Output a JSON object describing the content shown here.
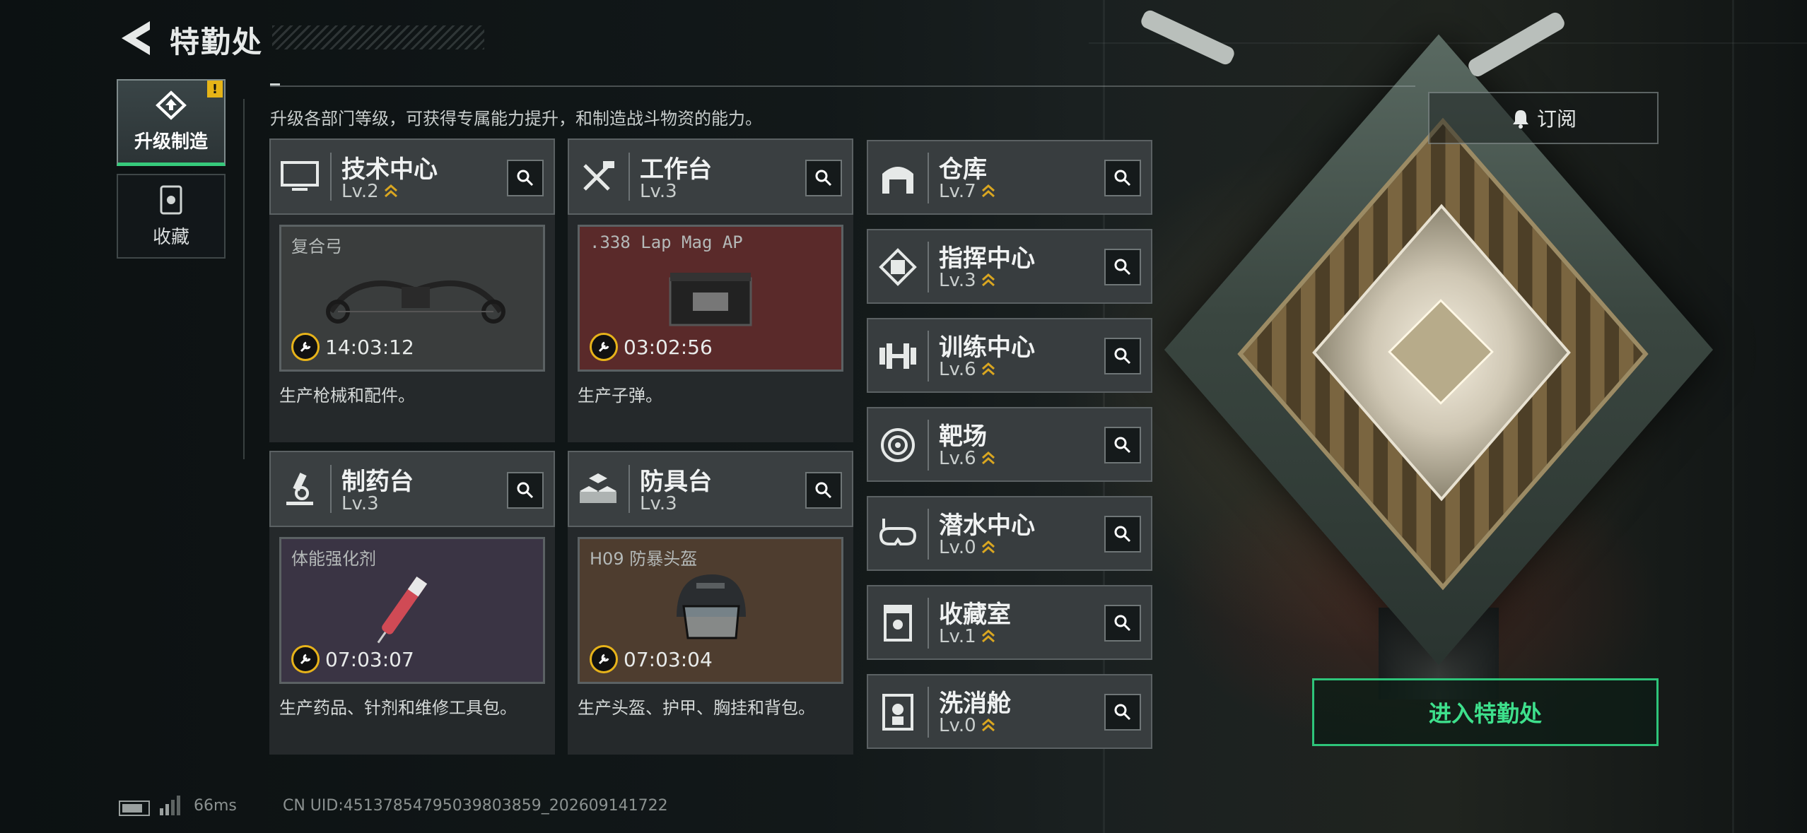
{
  "header": {
    "title": "特勤处",
    "description": "升级各部门等级，可获得专属能力提升，和制造战斗物资的能力。"
  },
  "tabs": [
    {
      "label": "升级制造",
      "icon": "upgrade-icon",
      "active": true,
      "badge": "!"
    },
    {
      "label": "收藏",
      "icon": "collection-icon",
      "active": false
    }
  ],
  "production": [
    {
      "title": "技术中心",
      "level": "Lv.2",
      "icon": "monitor-icon",
      "product": "复合弓",
      "timer": "14:03:12",
      "desc": "生产枪械和配件。",
      "color": "#3a3d3d"
    },
    {
      "title": "工作台",
      "level": "Lv.3",
      "icon": "tools-icon",
      "product": ".338 Lap Mag AP",
      "timer": "03:02:56",
      "desc": "生产子弹。",
      "color": "#5a2a2a"
    },
    {
      "title": "制药台",
      "level": "Lv.3",
      "icon": "microscope-icon",
      "product": "体能强化剂",
      "timer": "07:03:07",
      "desc": "生产药品、针剂和维修工具包。",
      "color": "#3a3444"
    },
    {
      "title": "防具台",
      "level": "Lv.3",
      "icon": "armor-blocks-icon",
      "product": "H09 防暴头盔",
      "timer": "07:03:04",
      "desc": "生产头盔、护甲、胸挂和背包。",
      "color": "#4e3d2f"
    }
  ],
  "facilities": [
    {
      "title": "仓库",
      "level": "Lv.7",
      "icon": "warehouse-icon"
    },
    {
      "title": "指挥中心",
      "level": "Lv.3",
      "icon": "command-chip-icon"
    },
    {
      "title": "训练中心",
      "level": "Lv.6",
      "icon": "dumbbell-icon"
    },
    {
      "title": "靶场",
      "level": "Lv.6",
      "icon": "target-icon"
    },
    {
      "title": "潜水中心",
      "level": "Lv.0",
      "icon": "diving-mask-icon"
    },
    {
      "title": "收藏室",
      "level": "Lv.1",
      "icon": "display-case-icon"
    },
    {
      "title": "洗消舱",
      "level": "Lv.0",
      "icon": "decon-pod-icon"
    }
  ],
  "buttons": {
    "subscribe": "订阅",
    "enter": "进入特勤处"
  },
  "footer": {
    "ping": "66ms",
    "uid": "CN UID:4513785479503980385​9_202609141722"
  },
  "colors": {
    "accent_green": "#2ec47a",
    "badge_yellow": "#e6b417",
    "chevron_gold": "#d9a621"
  }
}
